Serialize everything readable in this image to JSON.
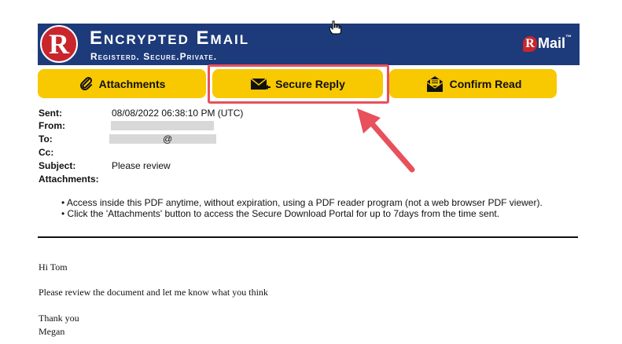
{
  "banner": {
    "logo_letter": "R",
    "title": "Encrypted Email",
    "tagline": "Registerd. Secure.Private.",
    "brand_r": "R",
    "brand_text": "Mail",
    "brand_tm": "™"
  },
  "toolbar": {
    "attachments_label": "Attachments",
    "secure_reply_label": "Secure Reply",
    "confirm_read_label": "Confirm Read"
  },
  "colors": {
    "banner": "#1d3a7a",
    "button": "#f8c800",
    "highlight": "#e8505b",
    "logo_red": "#c9252c"
  },
  "meta": {
    "sent_label": "Sent:",
    "sent_value": "08/08/2022 06:38:10 PM (UTC)",
    "from_label": "From:",
    "to_label": "To:",
    "to_partial": "@",
    "cc_label": "Cc:",
    "subject_label": "Subject:",
    "subject_value": "Please review",
    "attachments_label": "Attachments:"
  },
  "notes": [
    "• Access inside this PDF anytime, without expiration, using a PDF reader program (not a web browser PDF viewer).",
    "• Click the 'Attachments' button to access the Secure Download Portal for up to 7days from the time sent."
  ],
  "message": {
    "greeting": "Hi Tom",
    "body": "Please review the document and let me know what you think",
    "closing": "Thank you",
    "signature": "Megan"
  },
  "icons": [
    "paperclip-icon",
    "secure-reply-envelope-icon",
    "confirm-read-envelope-icon",
    "hand-cursor-icon",
    "annotation-arrow-icon"
  ]
}
